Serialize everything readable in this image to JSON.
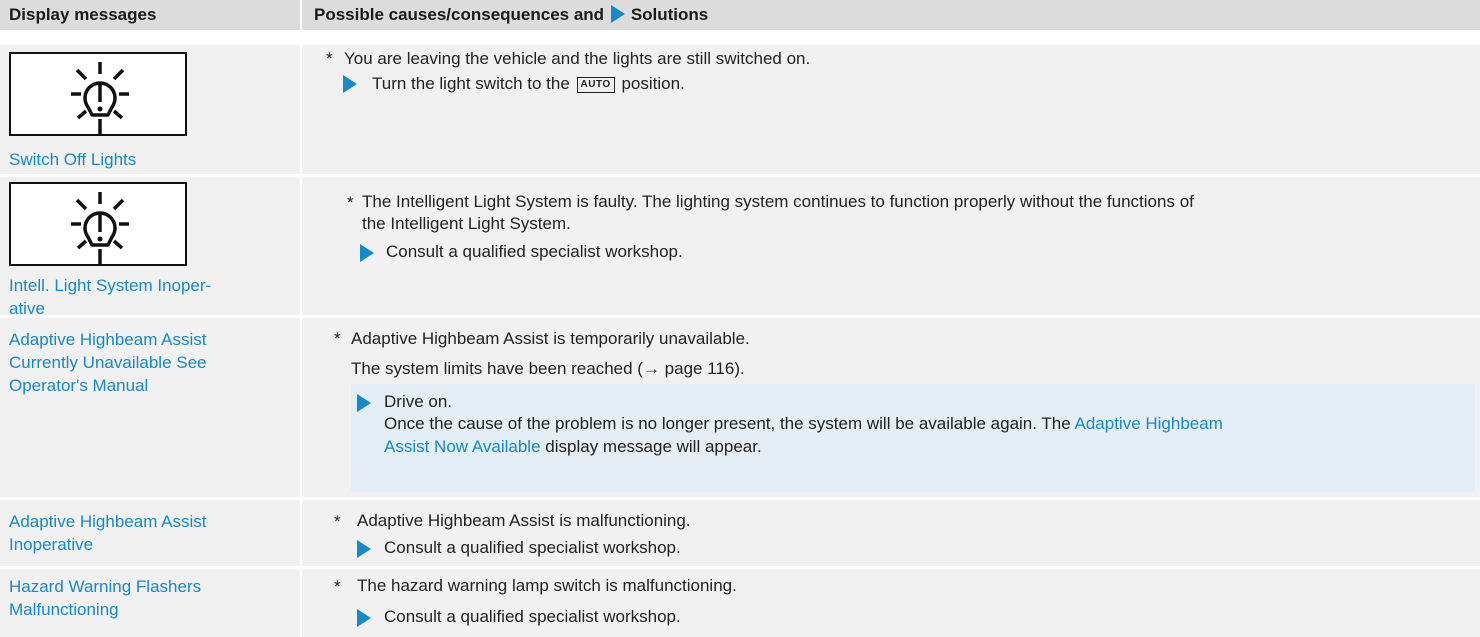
{
  "header": {
    "col1": "Display messages",
    "col2_prefix": "Possible causes/consequences and",
    "col2_suffix": "Solutions"
  },
  "rows": [
    {
      "icon": "light-warning-icon",
      "message": "Switch Off Lights",
      "cause": "You are leaving the vehicle and the lights are still switched on.",
      "step_before": "Turn the light switch to the",
      "step_key": "AUTO",
      "step_after": "position."
    },
    {
      "icon": "light-warning-icon",
      "message_line1": "Intell. Light System Inoper-",
      "message_line2": "ative",
      "cause_line1": "The Intelligent Light System is faulty. The lighting system continues to function properly without the functions of",
      "cause_line2": "the Intelligent Light System.",
      "step": "Consult a qualified specialist workshop."
    },
    {
      "message_line1": "Adaptive Highbeam Assist",
      "message_line2": "Currently Unavailable See",
      "message_line3": "Operator's Manual",
      "cause": "Adaptive Highbeam Assist is temporarily unavailable.",
      "note": "The system limits have been reached (→ page 116).",
      "step": "Drive on.",
      "step_detail_line1_a": "Once the cause of the problem is no longer present, the system will be available again. The",
      "step_detail_line1_link": "Adaptive Highbeam",
      "step_detail_line2_link": "Assist Now Available",
      "step_detail_line2_b": "display message will appear."
    },
    {
      "message_line1": "Adaptive Highbeam Assist",
      "message_line2": "Inoperative",
      "cause": "Adaptive Highbeam Assist is malfunctioning.",
      "step": "Consult a qualified specialist workshop."
    },
    {
      "message_line1": "Hazard Warning Flashers",
      "message_line2": "Malfunctioning",
      "cause": "The hazard warning lamp switch is malfunctioning.",
      "step": "Consult a qualified specialist workshop."
    }
  ],
  "bullet": "*",
  "colors": {
    "accent": "#1689c9",
    "header_bg": "#dcdcdc",
    "cell_bg": "#f1f1f1"
  }
}
